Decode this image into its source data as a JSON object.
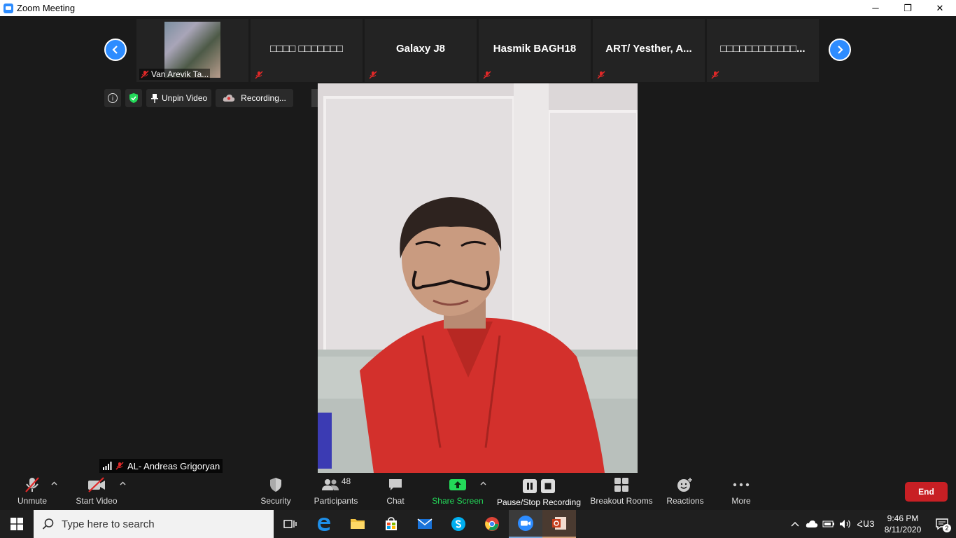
{
  "window": {
    "title": "Zoom Meeting",
    "controls": {
      "minimize": "─",
      "restore": "❐",
      "close": "✕"
    }
  },
  "thumbnails": [
    {
      "name": "Van Arevik Ta...",
      "has_photo": true
    },
    {
      "name": "□□□□ □□□□□□□",
      "has_photo": false
    },
    {
      "name": "Galaxy J8",
      "has_photo": false
    },
    {
      "name": "Hasmik BAGH18",
      "has_photo": false
    },
    {
      "name": "ART/ Yesther, A...",
      "has_photo": false
    },
    {
      "name": "□□□□□□□□□□□□...",
      "has_photo": false
    }
  ],
  "info_bar": {
    "info_glyph": "i",
    "unpin_label": "Unpin Video",
    "recording_label": "Recording..."
  },
  "speaker": {
    "name": "AL- Andreas Grigoryan"
  },
  "toolbar": {
    "unmute": "Unmute",
    "start_video": "Start Video",
    "security": "Security",
    "participants": "Participants",
    "participants_count": "48",
    "chat": "Chat",
    "share_screen": "Share Screen",
    "pause_stop_recording": "Pause/Stop Recording",
    "breakout_rooms": "Breakout Rooms",
    "reactions": "Reactions",
    "more": "More",
    "end": "End"
  },
  "taskbar": {
    "search_placeholder": "Type here to search",
    "ime": "ՀԱЗ",
    "time": "9:46 PM",
    "date": "8/11/2020",
    "notification_count": "2"
  },
  "colors": {
    "accent": "#2d8cff",
    "end": "#c81f24",
    "share_green": "#23d959",
    "muted_red": "#e02828"
  }
}
